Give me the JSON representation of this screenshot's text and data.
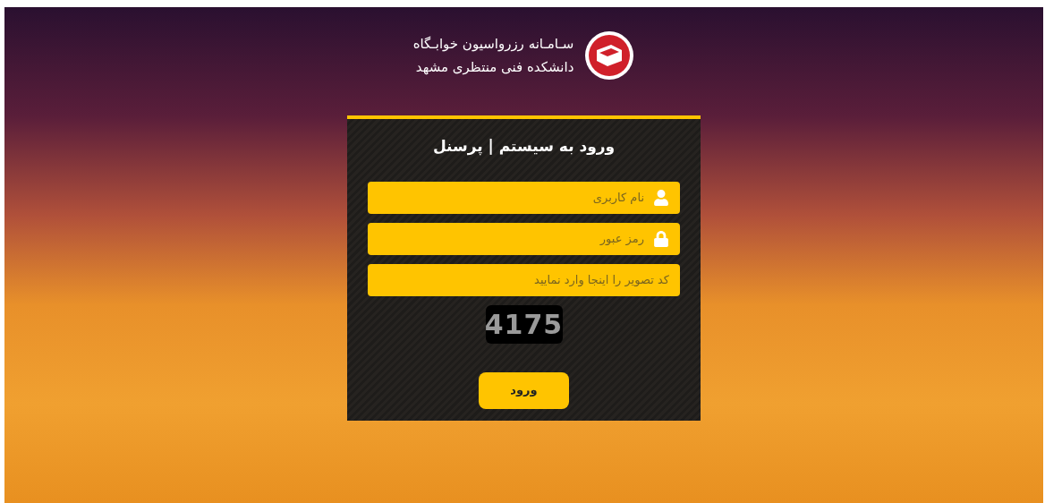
{
  "header": {
    "title": "سـامـانه رزرواسیون خوابـگاه",
    "subtitle": "دانشکده فنی منتظری مشهد"
  },
  "login": {
    "heading": "ورود به سیستم | پرسنل",
    "fields": [
      {
        "kind": "user",
        "placeholder": "نام کاربری"
      },
      {
        "kind": "password",
        "placeholder": "رمز عبور"
      },
      {
        "kind": "captcha",
        "placeholder": "کد تصویر را اینجا وارد نمایید"
      }
    ],
    "captcha": {
      "code": "4175"
    },
    "submit": "ورود"
  }
}
